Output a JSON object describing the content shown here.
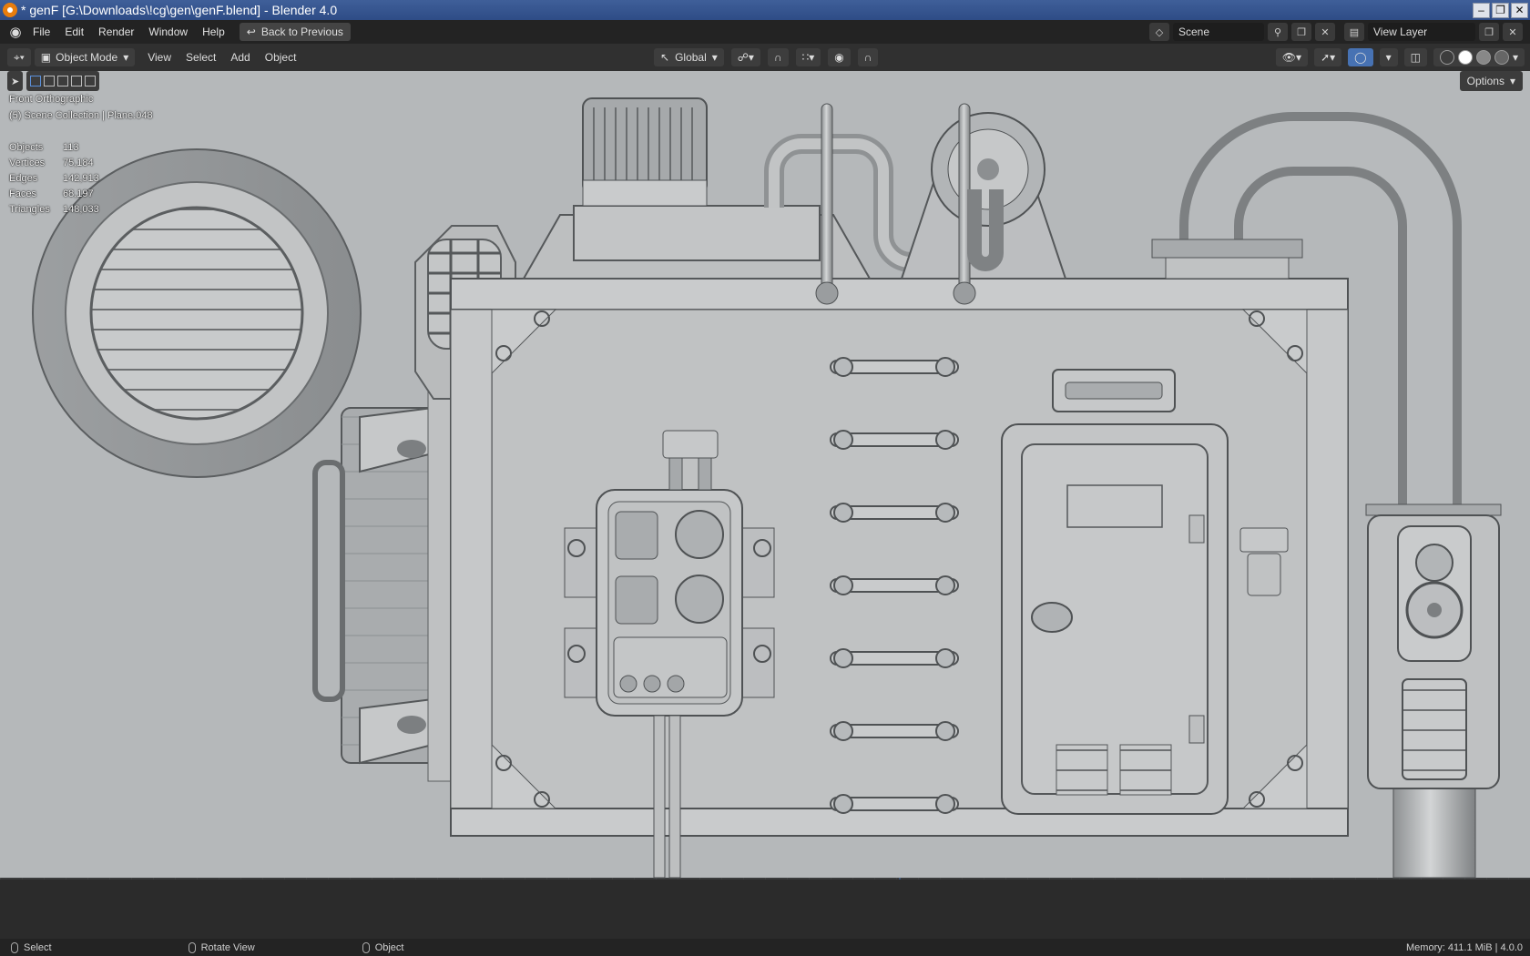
{
  "window": {
    "title": "* genF [G:\\Downloads\\!cg\\gen\\genF.blend] - Blender 4.0",
    "controls": [
      "minimize",
      "maximize",
      "close"
    ]
  },
  "menubar": {
    "items": [
      "File",
      "Edit",
      "Render",
      "Window",
      "Help"
    ],
    "back_button": "Back to Previous",
    "scene_label": "Scene",
    "view_layer_label": "View Layer"
  },
  "viewport_header": {
    "mode": "Object Mode",
    "menus": [
      "View",
      "Select",
      "Add",
      "Object"
    ],
    "transform_orientation": "Global"
  },
  "tool_settings": {
    "options_label": "Options"
  },
  "viewport": {
    "view_name": "Front Orthographic",
    "collection_info": "(5) Scene Collection | Plane.048",
    "stats": [
      {
        "label": "Objects",
        "value": "113"
      },
      {
        "label": "Vertices",
        "value": "75,184"
      },
      {
        "label": "Edges",
        "value": "142,913"
      },
      {
        "label": "Faces",
        "value": "68,197"
      },
      {
        "label": "Triangles",
        "value": "148,033"
      }
    ]
  },
  "statusbar": {
    "left_action": "Select",
    "middle_action": "Rotate View",
    "right_action": "Object",
    "memory": "Memory: 411.1 MiB | 4.0.0"
  },
  "colors": {
    "viewport_bg": "#b5b8ba",
    "floor": "#3a3b3c",
    "header": "#303030",
    "menubar": "#232323",
    "titlebar": "#2e4c86",
    "accent_blue": "#4772b3"
  }
}
